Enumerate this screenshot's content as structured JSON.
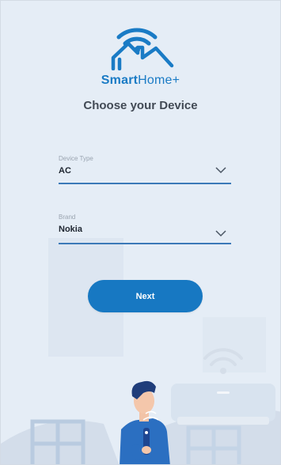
{
  "app": {
    "brand_bold": "Smart",
    "brand_light": "Home+",
    "title": "Choose your Device"
  },
  "form": {
    "device_type": {
      "label": "Device Type",
      "value": "AC"
    },
    "brand": {
      "label": "Brand",
      "value": "Nokia"
    }
  },
  "actions": {
    "next_label": "Next"
  },
  "colors": {
    "background": "#e5edf6",
    "accent": "#1778c2",
    "underline": "#3b79b8",
    "title_text": "#424a55"
  },
  "icons": [
    "smart-home-logo-icon",
    "chevron-down-icon",
    "wifi-icon",
    "air-conditioner-icon"
  ]
}
